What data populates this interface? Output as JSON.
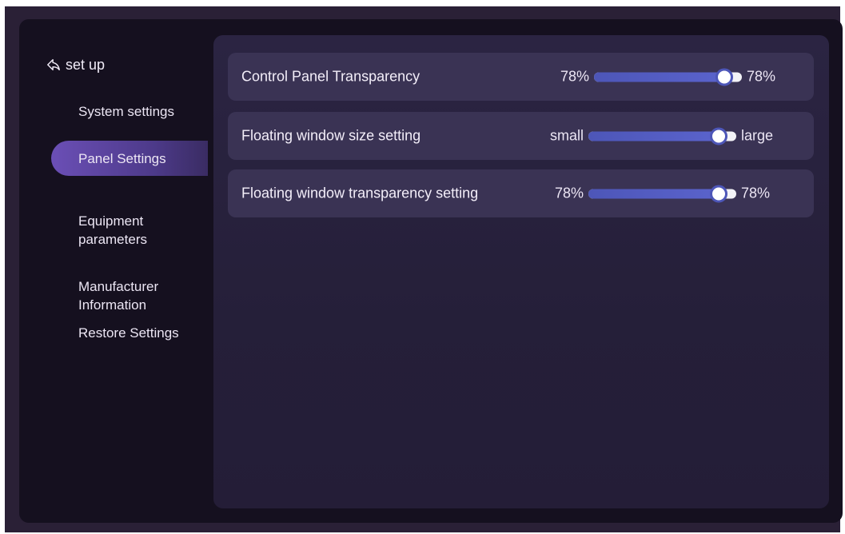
{
  "sidebar": {
    "back_label": "set up",
    "items": [
      {
        "label": "System settings"
      },
      {
        "label": "Panel Settings"
      },
      {
        "label": "Equipment\nparameters"
      },
      {
        "label": "Manufacturer\nInformation"
      },
      {
        "label": "Restore Settings"
      }
    ],
    "active_index": 1
  },
  "settings": [
    {
      "label": "Control Panel Transparency",
      "min_label": "78%",
      "max_label": "78%",
      "value_fraction": 0.88
    },
    {
      "label": "Floating window size setting",
      "min_label": "small",
      "max_label": "large",
      "value_fraction": 0.88
    },
    {
      "label": "Floating window transparency setting",
      "min_label": "78%",
      "max_label": "78%",
      "value_fraction": 0.88
    }
  ],
  "colors": {
    "accent": "#4d56b8",
    "active_item": "#6b4fb6",
    "background": "#15101f",
    "panel": "#2b2442",
    "row": "#3a3354"
  },
  "icons": {
    "back": "back-arrow-icon"
  }
}
